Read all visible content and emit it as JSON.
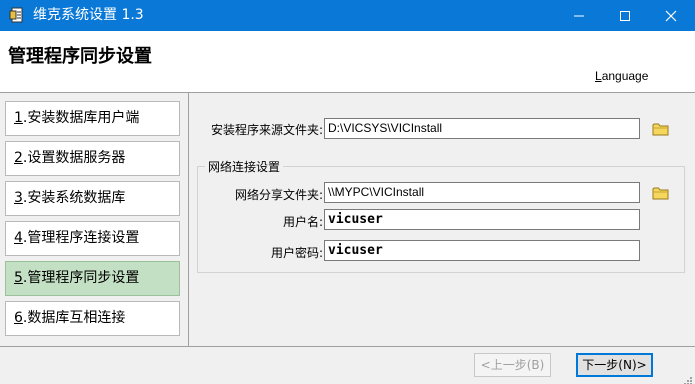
{
  "window": {
    "title": "维克系统设置 1.3",
    "icon": "app-document-icon",
    "controls": [
      "minimize-icon",
      "maximize-icon",
      "close-icon"
    ]
  },
  "header": {
    "title": "管理程序同步设置",
    "language_label": "Language",
    "language_accel": "L",
    "language_rest": "anguage"
  },
  "nav": {
    "items": [
      {
        "num": "1",
        "text": ".安装数据库用户端",
        "active": false
      },
      {
        "num": "2",
        "text": ".设置数据服务器",
        "active": false
      },
      {
        "num": "3",
        "text": ".安装系统数据库",
        "active": false
      },
      {
        "num": "4",
        "text": ".管理程序连接设置",
        "active": false
      },
      {
        "num": "5",
        "text": ".管理程序同步设置",
        "active": true
      },
      {
        "num": "6",
        "text": ".数据库互相连接",
        "active": false
      }
    ],
    "active_color": "#c4e0c4"
  },
  "form": {
    "source_label": "安装程序来源文件夹:",
    "source_value": "D:\\VICSYS\\VICInstall",
    "group_title": "网络连接设置",
    "share_label": "网络分享文件夹:",
    "share_value": "\\\\MYPC\\VICInstall",
    "user_label": "用户名:",
    "user_value": "vicuser",
    "password_label": "用户密码:",
    "password_value": "vicuser",
    "folder_icon": "folder-icon"
  },
  "footer": {
    "prev_label": "<上一步(B)",
    "next_label": "下一步(N)>"
  },
  "colors": {
    "titlebar": "#0a78d7",
    "accent": "#0078d7"
  }
}
